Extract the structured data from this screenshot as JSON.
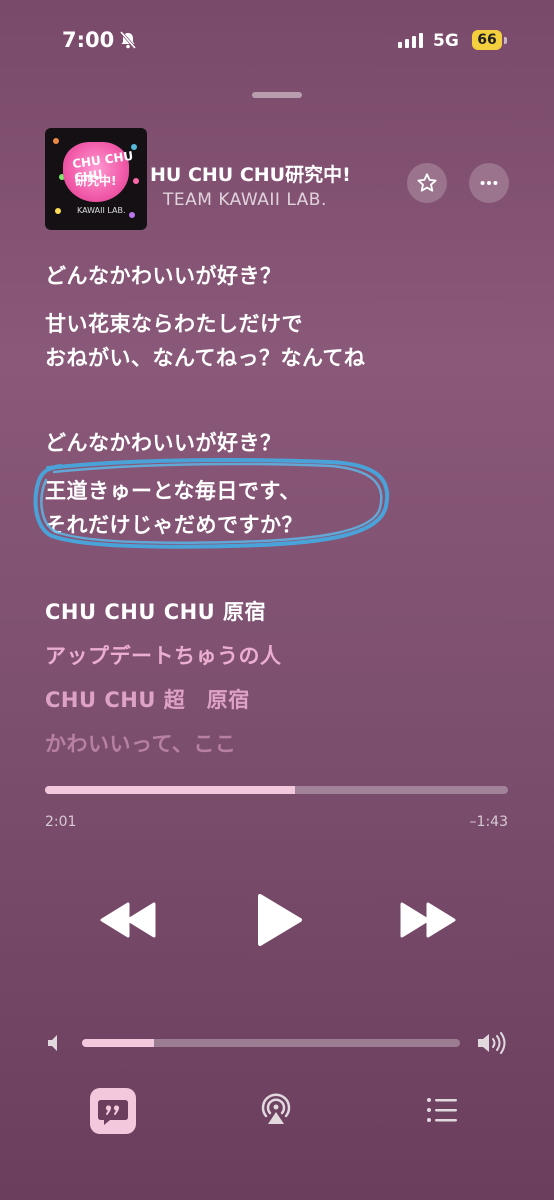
{
  "status_bar": {
    "time": "7:00",
    "network": "5G",
    "battery": "66"
  },
  "now_playing": {
    "title": "HU CHU CHU研究中!",
    "artist": "TEAM KAWAII LAB.",
    "artwork_text_1": "CHU CHU CHU",
    "artwork_text_2": "研究中!",
    "artwork_text_3": "KAWAII LAB."
  },
  "lyrics": [
    "どんなかわいいが好き？",
    "甘い花束ならわたしだけで",
    "おねがい、なんてねっ？なんてね",
    "どんなかわいいが好き？",
    "王道きゅーとな毎日です、",
    "それだけじゃだめですか？",
    "CHU CHU CHU 原宿",
    "アップデートちゅうの人",
    "CHU CHU 超　原宿",
    "かわいいって、ここ"
  ],
  "playback": {
    "elapsed": "2:01",
    "remaining": "–1:43",
    "progress_fraction": 0.54
  },
  "volume": {
    "level_fraction": 0.19
  },
  "icons": [
    "bell-slash-icon",
    "star-icon",
    "more-icon",
    "rewind-icon",
    "play-icon",
    "fast-forward-icon",
    "volume-low-icon",
    "volume-high-icon",
    "lyrics-icon",
    "airplay-icon",
    "queue-icon"
  ],
  "colors": {
    "accent": "#f3c8dc",
    "scribble": "#4aa3d8"
  }
}
